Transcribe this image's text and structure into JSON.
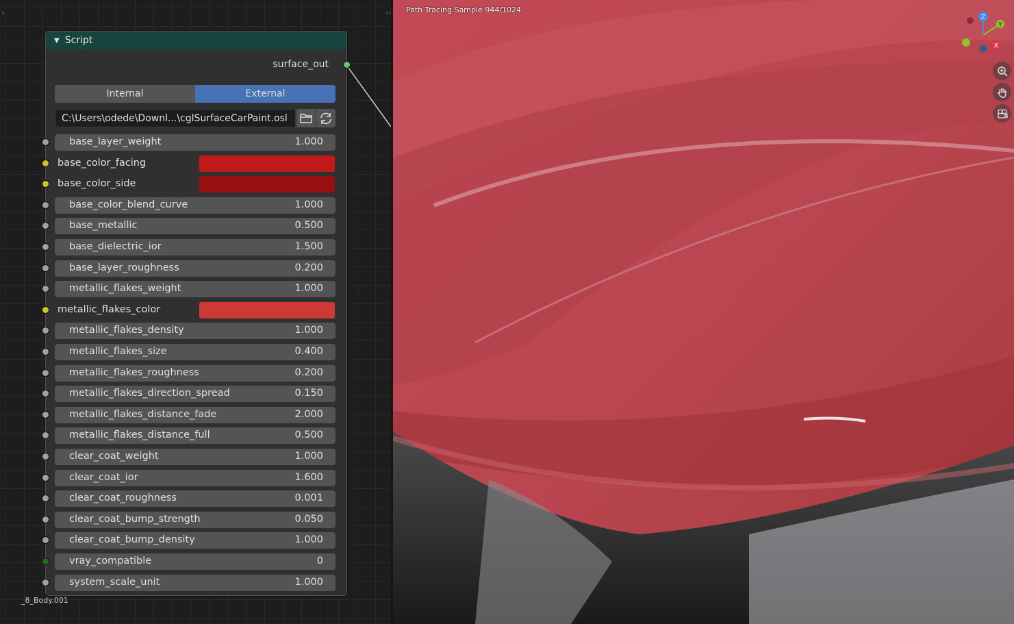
{
  "node_editor": {
    "node": {
      "title": "Script",
      "output_label": "surface_out",
      "mode_options": [
        "Internal",
        "External"
      ],
      "mode_selected": "External",
      "filepath": "C:\\Users\\odede\\Downl...\\cglSurfaceCarPaint.osl",
      "properties": [
        {
          "label": "base_layer_weight",
          "value": "1.000",
          "type": "float"
        },
        {
          "label": "base_color_facing",
          "color": "#c0191a",
          "type": "color"
        },
        {
          "label": "base_color_side",
          "color": "#970f11",
          "type": "color"
        },
        {
          "label": "base_color_blend_curve",
          "value": "1.000",
          "type": "float"
        },
        {
          "label": "base_metallic",
          "value": "0.500",
          "type": "float"
        },
        {
          "label": "base_dielectric_ior",
          "value": "1.500",
          "type": "float"
        },
        {
          "label": "base_layer_roughness",
          "value": "0.200",
          "type": "float"
        },
        {
          "label": "metallic_flakes_weight",
          "value": "1.000",
          "type": "float"
        },
        {
          "label": "metallic_flakes_color",
          "color": "#cd3a35",
          "type": "color"
        },
        {
          "label": "metallic_flakes_density",
          "value": "1.000",
          "type": "float"
        },
        {
          "label": "metallic_flakes_size",
          "value": "0.400",
          "type": "float"
        },
        {
          "label": "metallic_flakes_roughness",
          "value": "0.200",
          "type": "float"
        },
        {
          "label": "metallic_flakes_direction_spread",
          "value": "0.150",
          "type": "float"
        },
        {
          "label": "metallic_flakes_distance_fade",
          "value": "2.000",
          "type": "float"
        },
        {
          "label": "metallic_flakes_distance_full",
          "value": "0.500",
          "type": "float"
        },
        {
          "label": "clear_coat_weight",
          "value": "1.000",
          "type": "float"
        },
        {
          "label": "clear_coat_ior",
          "value": "1.600",
          "type": "float"
        },
        {
          "label": "clear_coat_roughness",
          "value": "0.001",
          "type": "float"
        },
        {
          "label": "clear_coat_bump_strength",
          "value": "0.050",
          "type": "float"
        },
        {
          "label": "clear_coat_bump_density",
          "value": "1.000",
          "type": "float"
        },
        {
          "label": "vray_compatible",
          "value": "0",
          "type": "int"
        },
        {
          "label": "system_scale_unit",
          "value": "1.000",
          "type": "float"
        }
      ]
    },
    "material_name": "_8_Body.001"
  },
  "viewport": {
    "render_status": "Path Tracing Sample 944/1024",
    "gizmo_axes": [
      "Z",
      "Y",
      "X"
    ],
    "nav_icons": [
      "zoom-icon",
      "pan-hand-icon",
      "camera-icon"
    ]
  },
  "colors": {
    "header_teal": "#17453e",
    "accent_blue": "#4772b3",
    "socket_grey": "#a1a1a1",
    "socket_yellow": "#c7c729",
    "socket_green_out": "#63c763",
    "socket_int_green": "#1f6e1f",
    "axis_x": "#e5354f",
    "axis_y": "#8ac32a",
    "axis_z": "#3a8ff0"
  }
}
